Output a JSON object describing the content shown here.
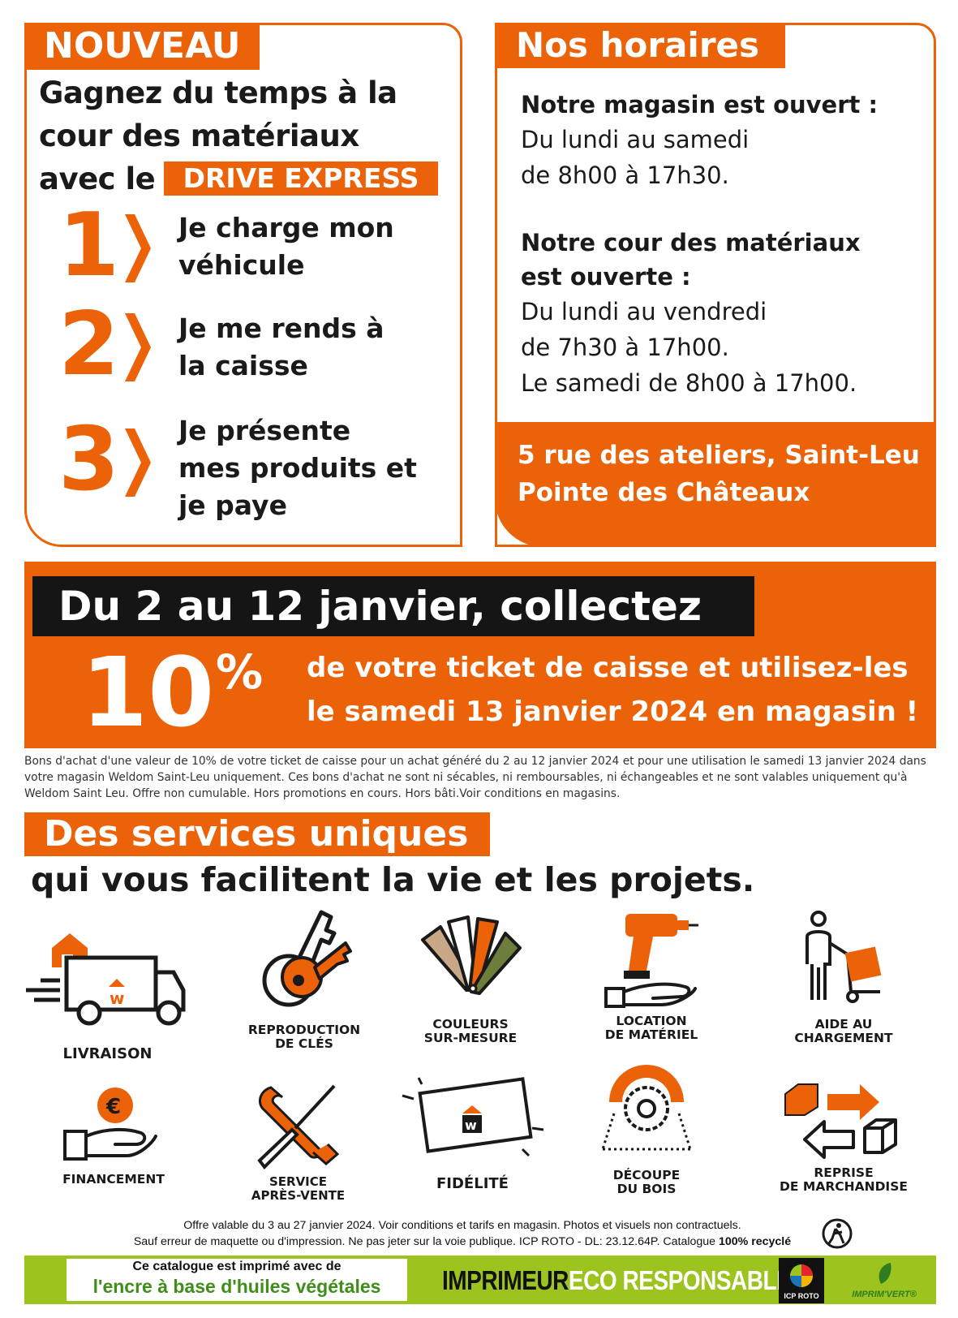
{
  "drive": {
    "tag": "NOUVEAU",
    "title_line1": "Gagnez du temps à la",
    "title_line2": "cour des matériaux",
    "title_line3": "avec le",
    "badge": "DRIVE EXPRESS",
    "steps": [
      {
        "num": "1",
        "line1": "Je charge mon",
        "line2": "véhicule",
        "line3": ""
      },
      {
        "num": "2",
        "line1": "Je me rends à",
        "line2": "la caisse",
        "line3": ""
      },
      {
        "num": "3",
        "line1": "Je présente",
        "line2": "mes produits et",
        "line3": "je paye"
      }
    ]
  },
  "hours": {
    "tag": "Nos horaires",
    "store_heading": "Notre magasin est ouvert :",
    "store_line1": "Du lundi au samedi",
    "store_line2": "de 8h00 à 17h30.",
    "yard_heading1": "Notre cour des matériaux",
    "yard_heading2": "est ouverte :",
    "yard_line1": "Du lundi au vendredi",
    "yard_line2": "de 7h30 à 17h00.",
    "yard_line3": "Le samedi de 8h00 à 17h00.",
    "address_line1": "5 rue des ateliers, Saint-Leu",
    "address_line2": "Pointe des Châteaux"
  },
  "promo": {
    "headline": "Du 2 au 12 janvier, collectez",
    "percent": "10",
    "percent_sign": "%",
    "text_line1": "de votre ticket de caisse et utilisez-les",
    "text_line2": "le samedi 13 janvier 2024 en magasin !",
    "fine_print": "Bons d'achat d'une valeur de 10% de votre ticket de caisse pour un achat généré du 2 au 12 janvier 2024 et pour une utilisation le samedi 13 janvier 2024 dans votre magasin Weldom Saint-Leu uniquement. Ces bons d'achat ne sont ni sécables, ni remboursables, ni échangeables et ne sont valables uniquement qu'à Weldom Saint Leu. Offre non cumulable. Hors promotions en cours. Hors bâti.Voir conditions en magasins."
  },
  "services": {
    "tag": "Des services uniques",
    "subtitle": "qui vous facilitent la vie et les projets.",
    "items": [
      {
        "label1": "LIVRAISON",
        "label2": "",
        "icon": "delivery-truck-icon"
      },
      {
        "label1": "REPRODUCTION",
        "label2": "DE CLÉS",
        "icon": "keys-icon"
      },
      {
        "label1": "COULEURS",
        "label2": "SUR-MESURE",
        "icon": "color-swatch-icon"
      },
      {
        "label1": "LOCATION",
        "label2": "DE MATÉRIEL",
        "icon": "drill-rental-icon"
      },
      {
        "label1": "AIDE AU",
        "label2": "CHARGEMENT",
        "icon": "loading-help-icon"
      },
      {
        "label1": "FINANCEMENT",
        "label2": "",
        "icon": "euro-hand-icon"
      },
      {
        "label1": "SERVICE",
        "label2": "APRÈS-VENTE",
        "icon": "tools-icon"
      },
      {
        "label1": "FIDÉLITÉ",
        "label2": "",
        "icon": "loyalty-card-icon"
      },
      {
        "label1": "DÉCOUPE",
        "label2": "DU BOIS",
        "icon": "saw-blade-icon"
      },
      {
        "label1": "REPRISE",
        "label2": "DE MARCHANDISE",
        "icon": "return-goods-icon"
      }
    ]
  },
  "footer": {
    "legal_line1": "Offre valable du 3 au 27 janvier 2024. Voir conditions et tarifs en magasin. Photos et visuels non contractuels.",
    "legal_line2": "Sauf erreur de maquette ou d'impression. Ne pas jeter sur la voie publique.  ICP ROTO - DL: 23.12.64P. Catalogue",
    "legal_bold": "100% recyclé",
    "ink_line1": "Ce catalogue est imprimé avec de",
    "ink_line2": "l'encre à base d'huiles végétales",
    "eco_part1": "IMPRIMEUR",
    "eco_part2": "ECO RESPONSABLE",
    "icp_logo_text": "ICP ROTO",
    "imprimvert_text": "IMPRIM'VERT®"
  },
  "colors": {
    "accent": "#ec6209",
    "dark": "#151515",
    "green": "#9cc31e"
  }
}
